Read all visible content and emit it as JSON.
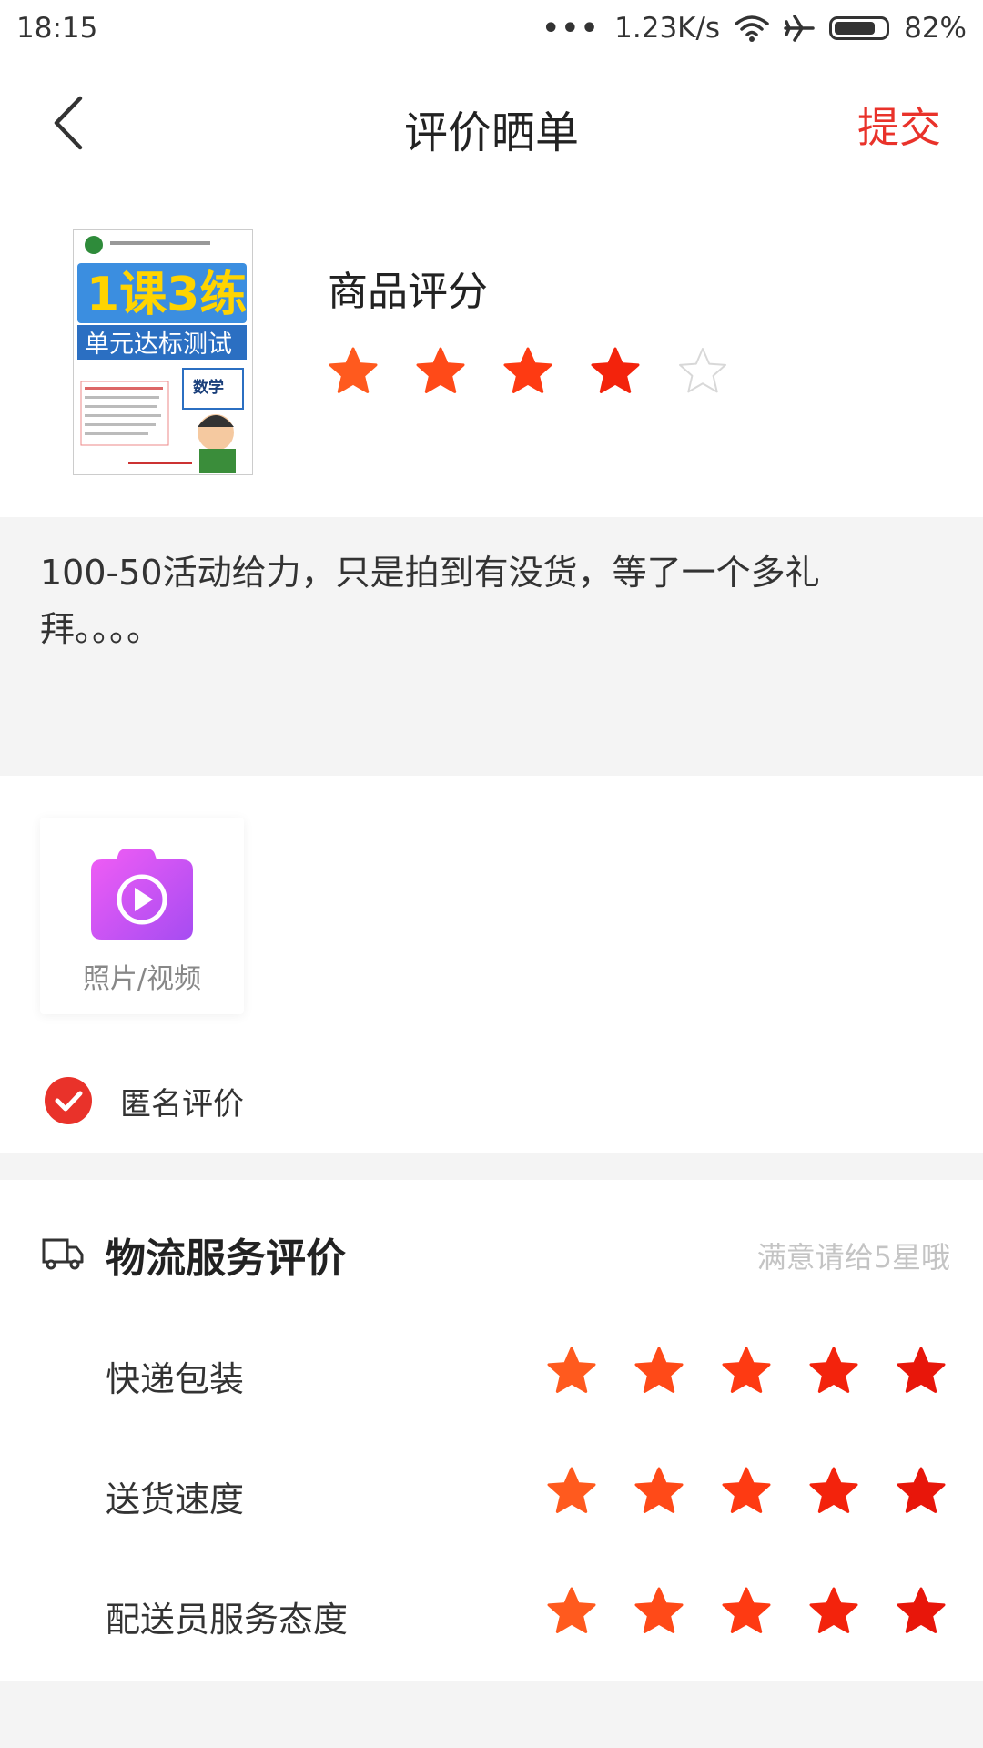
{
  "status_bar": {
    "time": "18:15",
    "dots": "•••",
    "network_speed": "1.23K/s",
    "battery_percent": "82%",
    "battery_level": 0.82,
    "icons": [
      "wifi-icon",
      "airplane-mode-icon",
      "battery-icon"
    ]
  },
  "nav": {
    "title": "评价晒单",
    "submit_label": "提交",
    "back_icon": "chevron-left-icon"
  },
  "product": {
    "rating_label": "商品评分",
    "rating": 4,
    "max_rating": 5,
    "image_title": "1课3练",
    "image_subtitle": "单元达标测试",
    "image_subject": "数学"
  },
  "review": {
    "text": "100-50活动给力，只是拍到有没货，等了一个多礼拜。。。。"
  },
  "media": {
    "upload_label": "照片/视频",
    "icon": "camera-video-icon"
  },
  "anonymous": {
    "label": "匿名评价",
    "checked": true
  },
  "logistics": {
    "title": "物流服务评价",
    "hint": "满意请给5星哦",
    "icon": "truck-icon",
    "items": [
      {
        "label": "快递包装",
        "rating": 5
      },
      {
        "label": "送货速度",
        "rating": 5
      },
      {
        "label": "配送员服务态度",
        "rating": 5
      }
    ]
  },
  "colors": {
    "accent": "#e9322a",
    "star_gradient": [
      "#ff5a1e",
      "#ff4a18",
      "#fe3a12",
      "#f3230c",
      "#e8160a"
    ],
    "star_empty": "#d8d8d8"
  }
}
